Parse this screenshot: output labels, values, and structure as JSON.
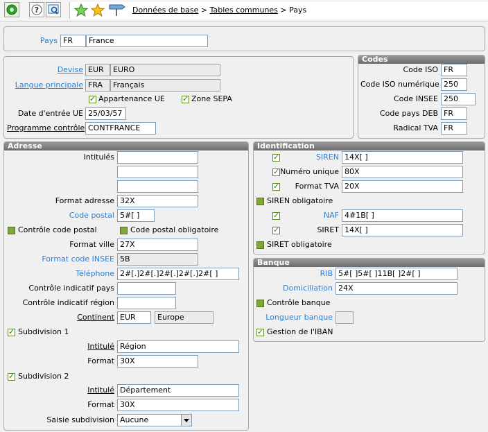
{
  "toolbar": {
    "icons": [
      "green-refresh-icon",
      "help-icon",
      "search-window-icon",
      "favorites-green-star-icon",
      "favorites-gold-star-icon",
      "signpost-icon"
    ],
    "breadcrumb": {
      "item1": "Données de base",
      "sep1": ">",
      "item2": "Tables communes",
      "sep2": ">",
      "current": "Pays"
    }
  },
  "pays": {
    "label": "Pays",
    "code": "FR",
    "name": "France"
  },
  "general": {
    "devise": {
      "label": "Devise",
      "code": "EUR",
      "name": "EURO"
    },
    "langue": {
      "label": "Langue principale",
      "code": "FRA",
      "name": "Français"
    },
    "appartenance_ue": {
      "label": "Appartenance UE",
      "checked": true
    },
    "zone_sepa": {
      "label": "Zone SEPA",
      "checked": true
    },
    "date_entree": {
      "label": "Date d'entrée UE",
      "value": "25/03/57"
    },
    "programme": {
      "label": "Programme contrôle",
      "value": "CONTFRANCE"
    }
  },
  "codes": {
    "title": "Codes",
    "iso": {
      "label": "Code ISO",
      "value": "FR"
    },
    "iso_num": {
      "label": "Code ISO numérique",
      "value": "250"
    },
    "insee": {
      "label": "Code INSEE",
      "value": "250"
    },
    "deb": {
      "label": "Code pays DEB",
      "value": "FR"
    },
    "tva": {
      "label": "Radical TVA",
      "value": "FR"
    }
  },
  "adresse": {
    "title": "Adresse",
    "intitules": {
      "label": "Intitulés",
      "values": [
        "",
        "",
        ""
      ]
    },
    "format_adresse": {
      "label": "Format adresse",
      "value": "32X"
    },
    "code_postal": {
      "label": "Code postal",
      "value": "5#[ ]"
    },
    "controle_cp": {
      "label": "Contrôle code postal",
      "checked": false
    },
    "cp_obligatoire": {
      "label": "Code postal obligatoire",
      "checked": false
    },
    "format_ville": {
      "label": "Format ville",
      "value": "27X"
    },
    "format_insee": {
      "label": "Format code INSEE",
      "value": "5B"
    },
    "telephone": {
      "label": "Téléphone",
      "value": "2#[.]2#[.]2#[.]2#[.]2#[ ]"
    },
    "ctrl_indicatif_pays": {
      "label": "Contrôle indicatif pays",
      "value": ""
    },
    "ctrl_indicatif_region": {
      "label": "Contrôle indicatif région",
      "value": ""
    },
    "continent": {
      "label": "Continent",
      "code": "EUR",
      "name": "Europe"
    },
    "subdiv1": {
      "label": "Subdivision 1",
      "checked": true,
      "intitule_label": "Intitulé",
      "intitule": "Région",
      "format_label": "Format",
      "format": "30X"
    },
    "subdiv2": {
      "label": "Subdivision 2",
      "checked": true,
      "intitule_label": "Intitulé",
      "intitule": "Département",
      "format_label": "Format",
      "format": "30X"
    },
    "saisie": {
      "label": "Saisie subdivision",
      "value": "Aucune"
    }
  },
  "identification": {
    "title": "Identification",
    "siren": {
      "label": "SIREN",
      "checked": true,
      "value": "14X[ ]"
    },
    "numero_unique": {
      "label": "Numéro unique",
      "checked": true,
      "value": "80X"
    },
    "format_tva": {
      "label": "Format TVA",
      "checked": true,
      "value": "20X"
    },
    "siren_oblig": {
      "label": "SIREN obligatoire",
      "checked": false
    },
    "naf": {
      "label": "NAF",
      "checked": true,
      "value": "4#1B[ ]"
    },
    "siret": {
      "label": "SIRET",
      "checked": true,
      "value": "14X[ ]"
    },
    "siret_oblig": {
      "label": "SIRET obligatoire",
      "checked": false
    }
  },
  "banque": {
    "title": "Banque",
    "rib": {
      "label": "RIB",
      "value": "5#[ ]5#[ ]11B[ ]2#[ ]"
    },
    "domiciliation": {
      "label": "Domiciliation",
      "value": "24X"
    },
    "controle": {
      "label": "Contrôle banque",
      "checked": false
    },
    "longueur": {
      "label": "Longueur banque",
      "value": ""
    },
    "iban": {
      "label": "Gestion de l'IBAN",
      "checked": true
    }
  }
}
